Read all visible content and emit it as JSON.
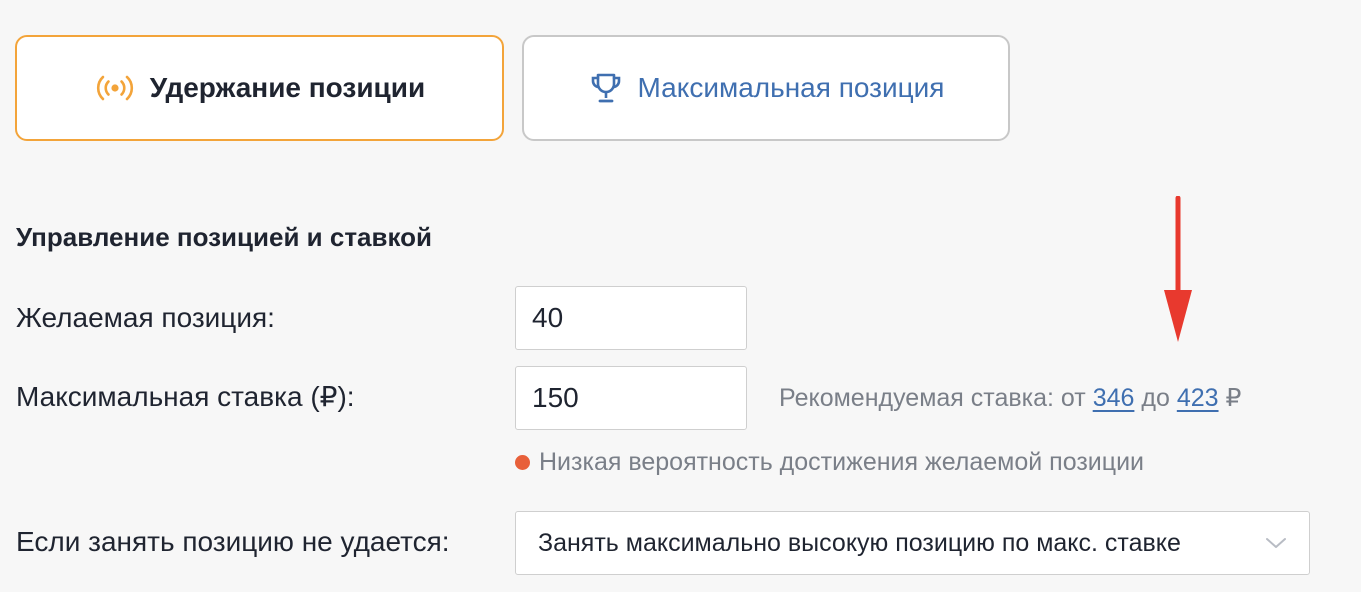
{
  "tabs": {
    "hold": {
      "label": "Удержание позиции",
      "icon": "broadcast-icon",
      "selected": true
    },
    "max": {
      "label": "Максимальная позиция",
      "icon": "trophy-icon",
      "selected": false
    }
  },
  "section": {
    "title": "Управление позицией и ставкой"
  },
  "position": {
    "label": "Желаемая позиция:",
    "value": "40"
  },
  "bid": {
    "label": "Максимальная ставка (₽):",
    "value": "150",
    "recommend_prefix": "Рекомендуемая ставка: от",
    "recommend_min": "346",
    "recommend_mid": "до",
    "recommend_max": "423",
    "recommend_currency": "₽"
  },
  "warning": {
    "text": "Низкая вероятность достижения желаемой позиции",
    "color": "#e8603a"
  },
  "fallback": {
    "label": "Если занять позицию не удается:",
    "selected": "Занять максимально высокую позицию по макс. ставке"
  },
  "colors": {
    "accent_orange": "#f3a43a",
    "link_blue": "#3f6fb0",
    "annotation_red": "#e8392e"
  }
}
